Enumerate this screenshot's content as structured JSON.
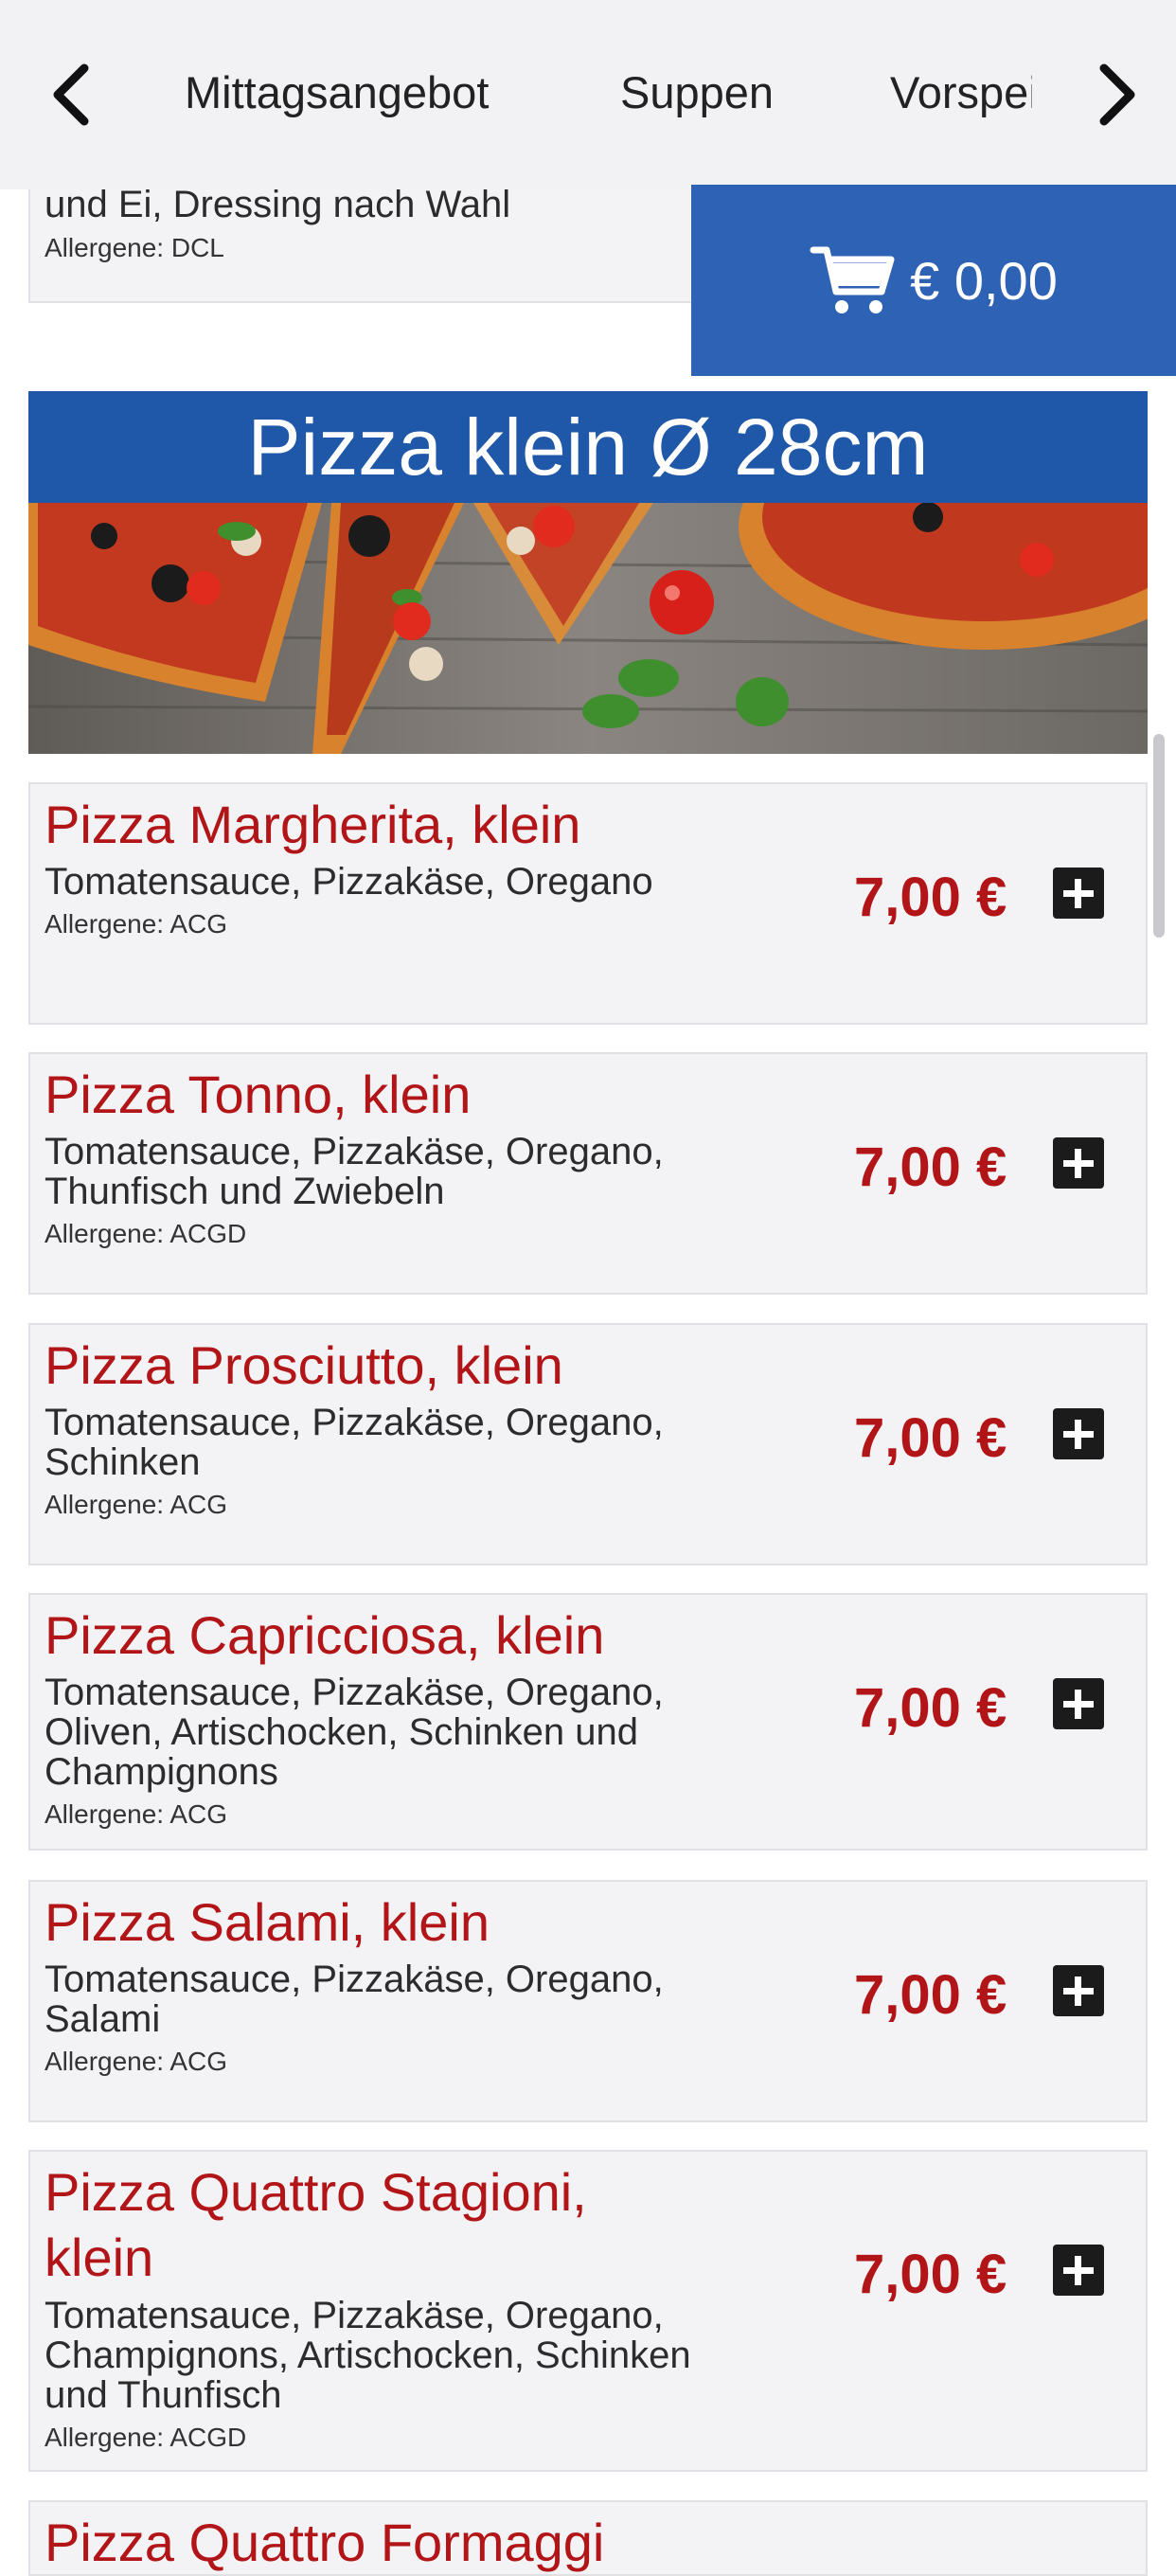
{
  "nav": {
    "tabs": [
      "Mittagsangebot",
      "Suppen",
      "Vorspeisen"
    ]
  },
  "previous_item": {
    "description": "und Ei, Dressing nach Wahl",
    "allergens": "Allergene: DCL"
  },
  "cart": {
    "total": "€ 0,00"
  },
  "section": {
    "title": "Pizza klein Ø 28cm"
  },
  "items": [
    {
      "name": "Pizza Margherita, klein",
      "description": "Tomatensauce, Pizzakäse, Oregano",
      "allergens": "Allergene: ACG",
      "price": "7,00 €"
    },
    {
      "name": "Pizza Tonno, klein",
      "description": "Tomatensauce, Pizzakäse, Oregano, Thunfisch und Zwiebeln",
      "allergens": "Allergene: ACGD",
      "price": "7,00 €"
    },
    {
      "name": "Pizza Prosciutto, klein",
      "description": "Tomatensauce, Pizzakäse, Oregano, Schinken",
      "allergens": "Allergene: ACG",
      "price": "7,00 €"
    },
    {
      "name": "Pizza Capricciosa, klein",
      "description": "Tomatensauce, Pizzakäse, Oregano, Oliven, Artischocken, Schinken und Champignons",
      "allergens": "Allergene: ACG",
      "price": "7,00 €"
    },
    {
      "name": "Pizza Salami, klein",
      "description": "Tomatensauce, Pizzakäse, Oregano, Salami",
      "allergens": "Allergene: ACG",
      "price": "7,00 €"
    },
    {
      "name": "Pizza Quattro Stagioni, klein",
      "description": "Tomatensauce, Pizzakäse, Oregano, Champignons, Artischocken, Schinken und Thunfisch",
      "allergens": "Allergene: ACGD",
      "price": "7,00 €"
    },
    {
      "name": "Pizza Quattro Formaggi"
    }
  ],
  "colors": {
    "brand_blue": "#1f58a8",
    "cart_blue": "#2e62b4",
    "accent_red": "#b21517",
    "card_bg": "#f3f2f5"
  }
}
